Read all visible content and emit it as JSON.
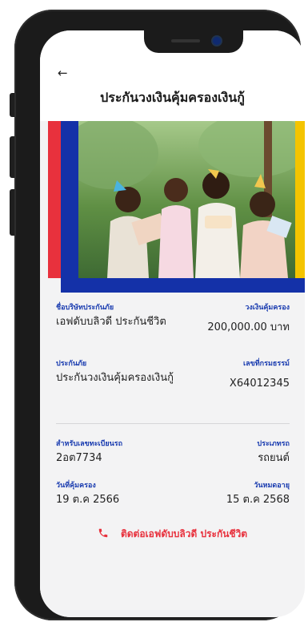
{
  "header": {
    "back_icon": "←",
    "title": "ประกันวงเงินคุ้มครองเงินกู้"
  },
  "banner": {
    "colors": {
      "red": "#e8313d",
      "blue": "#1431a8",
      "yellow": "#f4c400"
    }
  },
  "policy": {
    "insurer_label": "ชื่อบริษัทประกันภัย",
    "insurer_value": "เอฟดับบลิวดี ประกันชีวิต",
    "coverage_label": "วงเงินคุ้มครอง",
    "coverage_value": "200,000.00 บาท",
    "product_label": "ประกันภัย",
    "product_value": "ประกันวงเงินคุ้มครองเงินกู้",
    "policy_no_label": "เลขที่กรมธรรม์",
    "policy_no_value": "X64012345",
    "plate_label": "สำหรับเลขทะเบียนรถ",
    "plate_value": "2อต7734",
    "vehicle_type_label": "ประเภทรถ",
    "vehicle_type_value": "รถยนต์",
    "start_label": "วันที่คุ้มครอง",
    "start_value": "19 ต.ค 2566",
    "end_label": "วันหมดอายุ",
    "end_value": "15 ต.ค 2568"
  },
  "contact": {
    "icon": "phone-icon",
    "label": "ติดต่อเอฟดับบลิวดี ประกันชีวิต"
  }
}
